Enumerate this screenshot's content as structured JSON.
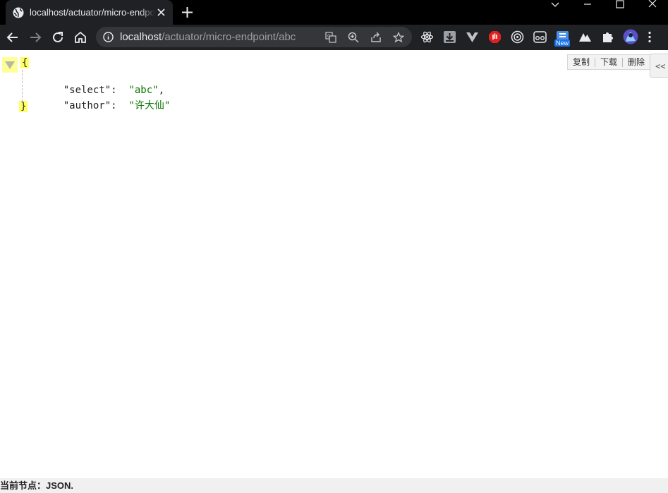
{
  "tab": {
    "title": "localhost/actuator/micro-endpoint/abc",
    "favicon": "globe-icon"
  },
  "window_controls": [
    "chevron-down-icon",
    "minimize-icon",
    "maximize-icon",
    "close-icon"
  ],
  "toolbar": {
    "url_host": "localhost",
    "url_path": "/actuator/micro-endpoint/abc",
    "omnibox_icons": [
      "translate-icon",
      "zoom-icon",
      "share-icon",
      "bookmark-star-icon"
    ],
    "extensions": [
      "react-devtools-icon",
      "download-extension-icon",
      "vue-devtools-icon",
      "stop-hand-icon",
      "target-icon",
      "glasses-icon",
      "new-extension-icon",
      "mountain-icon",
      "puzzle-icon",
      "profile-avatar"
    ],
    "new_badge": "New"
  },
  "json_viewer": {
    "open_brace": "{",
    "close_brace": "}",
    "entries": [
      {
        "key": "\"select\"",
        "value": "\"abc\"",
        "sep": ":  ",
        "trail": ","
      },
      {
        "key": "\"author\"",
        "value": "\"许大仙\"",
        "sep": ":  ",
        "trail": ""
      }
    ],
    "tools": {
      "copy": "复制",
      "download": "下载",
      "delete": "删除"
    },
    "collapse_label": "<<"
  },
  "status": {
    "text": "当前节点：JSON."
  },
  "colors": {
    "tabbar_bg": "#000000",
    "toolbar_bg": "#202124",
    "omnibox_bg": "#35363a",
    "json_value": "#0b7500",
    "brace_highlight": "#ffff66"
  }
}
